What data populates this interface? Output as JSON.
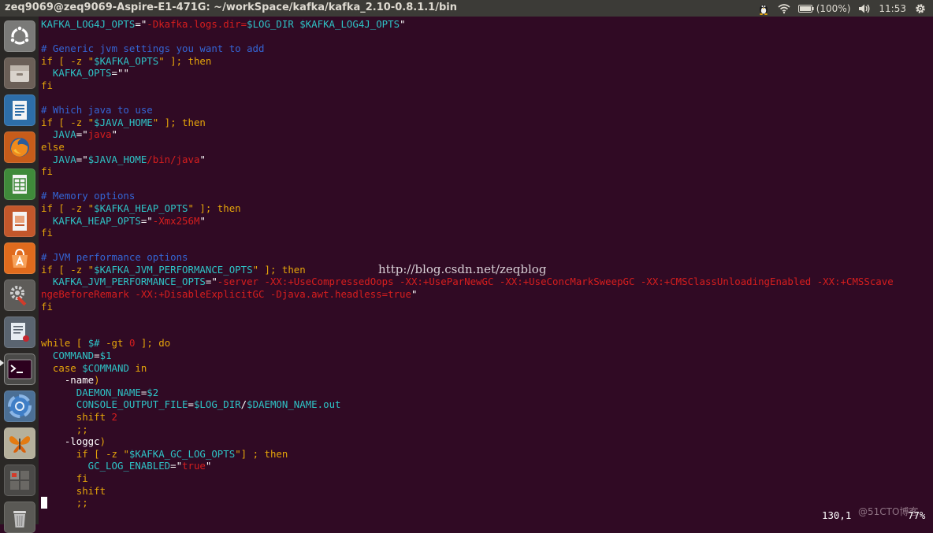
{
  "window": {
    "title": "zeq9069@zeq9069-Aspire-E1-471G: ~/workSpace/kafka/kafka_2.10-0.8.1.1/bin"
  },
  "tray": {
    "battery": "(100%)",
    "clock": "11:53",
    "icons": [
      "tux-icon",
      "wifi-icon",
      "battery-icon",
      "volume-icon",
      "gear-icon"
    ]
  },
  "launcher": {
    "items": [
      {
        "name": "ubuntu-dash-icon"
      },
      {
        "name": "file-manager-icon"
      },
      {
        "name": "writer-document-icon"
      },
      {
        "name": "firefox-icon"
      },
      {
        "name": "calc-spreadsheet-icon"
      },
      {
        "name": "impress-presentation-icon"
      },
      {
        "name": "software-center-icon"
      },
      {
        "name": "system-settings-icon"
      },
      {
        "name": "text-editor-icon"
      },
      {
        "name": "terminal-icon",
        "running": true
      },
      {
        "name": "chromium-icon"
      },
      {
        "name": "shotwell-butterfly-icon"
      },
      {
        "name": "workspace-switcher-icon"
      },
      {
        "name": "trash-icon"
      }
    ]
  },
  "terminal": {
    "lines": [
      [
        {
          "t": "KAFKA_LOG4J_OPTS",
          "c": "var"
        },
        {
          "t": "=\"",
          "c": "wht"
        },
        {
          "t": "-Dkafka.logs.dir=",
          "c": "str"
        },
        {
          "t": "$LOG_DIR $KAFKA_LOG4J_OPTS",
          "c": "var"
        },
        {
          "t": "\"",
          "c": "wht"
        }
      ],
      [],
      [
        {
          "t": "# Generic jvm settings you want to add",
          "c": "cmt"
        }
      ],
      [
        {
          "t": "if",
          "c": "kw"
        },
        {
          "t": " [ -z \"",
          "c": "kw"
        },
        {
          "t": "$KAFKA_OPTS",
          "c": "var"
        },
        {
          "t": "\" ]; then",
          "c": "kw"
        }
      ],
      [
        {
          "t": "  KAFKA_OPTS",
          "c": "var"
        },
        {
          "t": "=\"\"",
          "c": "wht"
        }
      ],
      [
        {
          "t": "fi",
          "c": "kw"
        }
      ],
      [],
      [
        {
          "t": "# Which java to use",
          "c": "cmt"
        }
      ],
      [
        {
          "t": "if",
          "c": "kw"
        },
        {
          "t": " [ -z \"",
          "c": "kw"
        },
        {
          "t": "$JAVA_HOME",
          "c": "var"
        },
        {
          "t": "\" ]; then",
          "c": "kw"
        }
      ],
      [
        {
          "t": "  JAVA",
          "c": "var"
        },
        {
          "t": "=\"",
          "c": "wht"
        },
        {
          "t": "java",
          "c": "str"
        },
        {
          "t": "\"",
          "c": "wht"
        }
      ],
      [
        {
          "t": "else",
          "c": "kw"
        }
      ],
      [
        {
          "t": "  JAVA",
          "c": "var"
        },
        {
          "t": "=\"",
          "c": "wht"
        },
        {
          "t": "$JAVA_HOME",
          "c": "var"
        },
        {
          "t": "/bin/java",
          "c": "str"
        },
        {
          "t": "\"",
          "c": "wht"
        }
      ],
      [
        {
          "t": "fi",
          "c": "kw"
        }
      ],
      [],
      [
        {
          "t": "# Memory options",
          "c": "cmt"
        }
      ],
      [
        {
          "t": "if",
          "c": "kw"
        },
        {
          "t": " [ -z \"",
          "c": "kw"
        },
        {
          "t": "$KAFKA_HEAP_OPTS",
          "c": "var"
        },
        {
          "t": "\" ]; then",
          "c": "kw"
        }
      ],
      [
        {
          "t": "  KAFKA_HEAP_OPTS",
          "c": "var"
        },
        {
          "t": "=\"",
          "c": "wht"
        },
        {
          "t": "-Xmx256M",
          "c": "str"
        },
        {
          "t": "\"",
          "c": "wht"
        }
      ],
      [
        {
          "t": "fi",
          "c": "kw"
        }
      ],
      [],
      [
        {
          "t": "# JVM performance options",
          "c": "cmt"
        }
      ],
      [
        {
          "t": "if",
          "c": "kw"
        },
        {
          "t": " [ -z \"",
          "c": "kw"
        },
        {
          "t": "$KAFKA_JVM_PERFORMANCE_OPTS",
          "c": "var"
        },
        {
          "t": "\" ]; then",
          "c": "kw"
        }
      ],
      [
        {
          "t": "  KAFKA_JVM_PERFORMANCE_OPTS",
          "c": "var"
        },
        {
          "t": "=\"",
          "c": "wht"
        },
        {
          "t": "-server -XX:+UseCompressedOops -XX:+UseParNewGC -XX:+UseConcMarkSweepGC -XX:+CMSClassUnloadingEnabled -XX:+CMSScave",
          "c": "str"
        }
      ],
      [
        {
          "t": "ngeBeforeRemark -XX:+DisableExplicitGC -Djava.awt.headless=true",
          "c": "str"
        },
        {
          "t": "\"",
          "c": "wht"
        }
      ],
      [
        {
          "t": "fi",
          "c": "kw"
        }
      ],
      [],
      [],
      [
        {
          "t": "while",
          "c": "kw"
        },
        {
          "t": " [ ",
          "c": "kw"
        },
        {
          "t": "$#",
          "c": "var"
        },
        {
          "t": " -gt ",
          "c": "kw"
        },
        {
          "t": "0",
          "c": "str"
        },
        {
          "t": " ]; do",
          "c": "kw"
        }
      ],
      [
        {
          "t": "  COMMAND",
          "c": "var"
        },
        {
          "t": "=",
          "c": "wht"
        },
        {
          "t": "$1",
          "c": "var"
        }
      ],
      [
        {
          "t": "  case",
          "c": "kw"
        },
        {
          "t": " $COMMAND ",
          "c": "var"
        },
        {
          "t": "in",
          "c": "kw"
        }
      ],
      [
        {
          "t": "    -name",
          "c": "wht"
        },
        {
          "t": ")",
          "c": "kw"
        }
      ],
      [
        {
          "t": "      DAEMON_NAME",
          "c": "var"
        },
        {
          "t": "=",
          "c": "wht"
        },
        {
          "t": "$2",
          "c": "var"
        }
      ],
      [
        {
          "t": "      CONSOLE_OUTPUT_FILE",
          "c": "var"
        },
        {
          "t": "=",
          "c": "wht"
        },
        {
          "t": "$LOG_DIR",
          "c": "var"
        },
        {
          "t": "/",
          "c": "wht"
        },
        {
          "t": "$DAEMON_NAME",
          "c": "var"
        },
        {
          "t": ".out",
          "c": "var"
        }
      ],
      [
        {
          "t": "      shift ",
          "c": "kw"
        },
        {
          "t": "2",
          "c": "str"
        }
      ],
      [
        {
          "t": "      ;;",
          "c": "kw"
        }
      ],
      [
        {
          "t": "    -loggc",
          "c": "wht"
        },
        {
          "t": ")",
          "c": "kw"
        }
      ],
      [
        {
          "t": "      if",
          "c": "kw"
        },
        {
          "t": " [ -z \"",
          "c": "kw"
        },
        {
          "t": "$KAFKA_GC_LOG_OPTS",
          "c": "var"
        },
        {
          "t": "\"] ; then",
          "c": "kw"
        }
      ],
      [
        {
          "t": "        GC_LOG_ENABLED",
          "c": "var"
        },
        {
          "t": "=\"",
          "c": "wht"
        },
        {
          "t": "true",
          "c": "str"
        },
        {
          "t": "\"",
          "c": "wht"
        }
      ],
      [
        {
          "t": "      fi",
          "c": "kw"
        }
      ],
      [
        {
          "t": "      shift",
          "c": "kw"
        }
      ],
      [
        {
          "t": "      ;;",
          "c": "kw"
        }
      ]
    ],
    "status_position": "130,1",
    "status_percent": "77%"
  },
  "watermark": "http://blog.csdn.net/zeqblog",
  "corner_watermark": "@51CTO博客"
}
